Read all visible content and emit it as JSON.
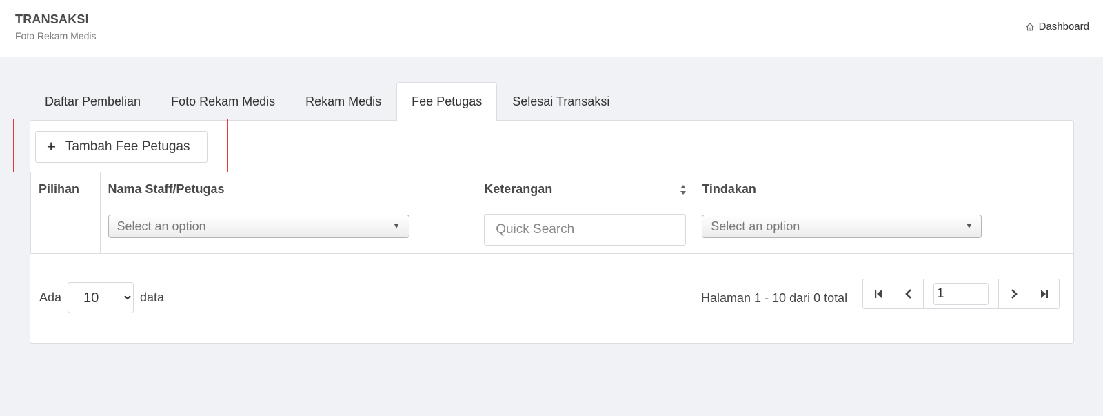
{
  "header": {
    "title": "TRANSAKSI",
    "subtitle": "Foto Rekam Medis",
    "breadcrumb": "Dashboard",
    "breadcrumb_icon": "home-icon"
  },
  "tabs": [
    {
      "label": "Daftar Pembelian",
      "active": false
    },
    {
      "label": "Foto Rekam Medis",
      "active": false
    },
    {
      "label": "Rekam Medis",
      "active": false
    },
    {
      "label": "Fee Petugas",
      "active": true
    },
    {
      "label": "Selesai Transaksi",
      "active": false
    }
  ],
  "toolbar": {
    "add_label": "Tambah Fee Petugas",
    "add_icon": "plus-icon"
  },
  "table": {
    "columns": [
      "Pilihan",
      "Nama Staff/Petugas",
      "Keterangan",
      "Tindakan"
    ],
    "filters": {
      "staff_select": "Select an option",
      "keterangan_placeholder": "Quick Search",
      "tindakan_select": "Select an option"
    }
  },
  "footer": {
    "show_prefix": "Ada",
    "page_size": "10",
    "page_size_options": [
      "10"
    ],
    "show_suffix": "data",
    "page_info": "Halaman 1 - 10 dari 0 total",
    "current_page": "1"
  },
  "colors": {
    "highlight": "#e03a3a",
    "background": "#f1f2f6"
  }
}
